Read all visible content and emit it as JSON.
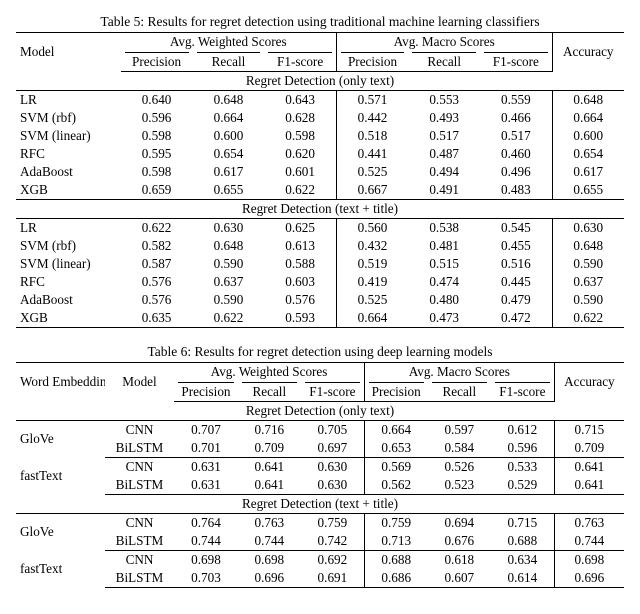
{
  "table5": {
    "caption": "Table 5: Results for regret detection using traditional machine learning classifiers",
    "head": {
      "model": "Model",
      "weighted": "Avg. Weighted Scores",
      "macro": "Avg. Macro Scores",
      "accuracy": "Accuracy",
      "sub": {
        "precision": "Precision",
        "recall": "Recall",
        "f1": "F1-score"
      }
    },
    "sectionA": "Regret Detection (only text)",
    "rowsA": [
      {
        "model": "LR",
        "wP": "0.640",
        "wR": "0.648",
        "wF": "0.643",
        "mP": "0.571",
        "mR": "0.553",
        "mF": "0.559",
        "acc": "0.648",
        "bold": true
      },
      {
        "model": "SVM (rbf)",
        "wP": "0.596",
        "wR": "0.664",
        "wF": "0.628",
        "mP": "0.442",
        "mR": "0.493",
        "mF": "0.466",
        "acc": "0.664"
      },
      {
        "model": "SVM (linear)",
        "wP": "0.598",
        "wR": "0.600",
        "wF": "0.598",
        "mP": "0.518",
        "mR": "0.517",
        "mF": "0.517",
        "acc": "0.600"
      },
      {
        "model": "RFC",
        "wP": "0.595",
        "wR": "0.654",
        "wF": "0.620",
        "mP": "0.441",
        "mR": "0.487",
        "mF": "0.460",
        "acc": "0.654"
      },
      {
        "model": "AdaBoost",
        "wP": "0.598",
        "wR": "0.617",
        "wF": "0.601",
        "mP": "0.525",
        "mR": "0.494",
        "mF": "0.496",
        "acc": "0.617"
      },
      {
        "model": "XGB",
        "wP": "0.659",
        "wR": "0.655",
        "wF": "0.622",
        "mP": "0.667",
        "mR": "0.491",
        "mF": "0.483",
        "acc": "0.655"
      }
    ],
    "sectionB": "Regret Detection (text + title)",
    "rowsB": [
      {
        "model": "LR",
        "wP": "0.622",
        "wR": "0.630",
        "wF": "0.625",
        "mP": "0.560",
        "mR": "0.538",
        "mF": "0.545",
        "acc": "0.630"
      },
      {
        "model": "SVM (rbf)",
        "wP": "0.582",
        "wR": "0.648",
        "wF": "0.613",
        "mP": "0.432",
        "mR": "0.481",
        "mF": "0.455",
        "acc": "0.648"
      },
      {
        "model": "SVM (linear)",
        "wP": "0.587",
        "wR": "0.590",
        "wF": "0.588",
        "mP": "0.519",
        "mR": "0.515",
        "mF": "0.516",
        "acc": "0.590"
      },
      {
        "model": "RFC",
        "wP": "0.576",
        "wR": "0.637",
        "wF": "0.603",
        "mP": "0.419",
        "mR": "0.474",
        "mF": "0.445",
        "acc": "0.637"
      },
      {
        "model": "AdaBoost",
        "wP": "0.576",
        "wR": "0.590",
        "wF": "0.576",
        "mP": "0.525",
        "mR": "0.480",
        "mF": "0.479",
        "acc": "0.590"
      },
      {
        "model": "XGB",
        "wP": "0.635",
        "wR": "0.622",
        "wF": "0.593",
        "mP": "0.664",
        "mR": "0.473",
        "mF": "0.472",
        "acc": "0.622"
      }
    ]
  },
  "table6": {
    "caption": "Table 6: Results for regret detection using deep learning models",
    "head": {
      "embedding": "Word Embedding",
      "model": "Model",
      "weighted": "Avg. Weighted Scores",
      "macro": "Avg. Macro Scores",
      "accuracy": "Accuracy",
      "sub": {
        "precision": "Precision",
        "recall": "Recall",
        "f1": "F1-score"
      }
    },
    "sectionA": "Regret Detection (only text)",
    "groupsA": [
      {
        "emb": "GloVe",
        "rows": [
          {
            "model": "CNN",
            "wP": "0.707",
            "wR": "0.716",
            "wF": "0.705",
            "mP": "0.664",
            "mR": "0.597",
            "mF": "0.612",
            "acc": "0.715"
          },
          {
            "model": "BiLSTM",
            "wP": "0.701",
            "wR": "0.709",
            "wF": "0.697",
            "mP": "0.653",
            "mR": "0.584",
            "mF": "0.596",
            "acc": "0.709"
          }
        ]
      },
      {
        "emb": "fastText",
        "rows": [
          {
            "model": "CNN",
            "wP": "0.631",
            "wR": "0.641",
            "wF": "0.630",
            "mP": "0.569",
            "mR": "0.526",
            "mF": "0.533",
            "acc": "0.641"
          },
          {
            "model": "BiLSTM",
            "wP": "0.631",
            "wR": "0.641",
            "wF": "0.630",
            "mP": "0.562",
            "mR": "0.523",
            "mF": "0.529",
            "acc": "0.641"
          }
        ]
      }
    ],
    "sectionB": "Regret Detection (text + title)",
    "groupsB": [
      {
        "emb": "GloVe",
        "rows": [
          {
            "model": "CNN",
            "wP": "0.764",
            "wR": "0.763",
            "wF": "0.759",
            "mP": "0.759",
            "mR": "0.694",
            "mF": "0.715",
            "acc": "0.763",
            "bold": true
          },
          {
            "model": "BiLSTM",
            "wP": "0.744",
            "wR": "0.744",
            "wF": "0.742",
            "mP": "0.713",
            "mR": "0.676",
            "mF": "0.688",
            "acc": "0.744"
          }
        ]
      },
      {
        "emb": "fastText",
        "rows": [
          {
            "model": "CNN",
            "wP": "0.698",
            "wR": "0.698",
            "wF": "0.692",
            "mP": "0.688",
            "mR": "0.618",
            "mF": "0.634",
            "acc": "0.698"
          },
          {
            "model": "BiLSTM",
            "wP": "0.703",
            "wR": "0.696",
            "wF": "0.691",
            "mP": "0.686",
            "mR": "0.607",
            "mF": "0.614",
            "acc": "0.696"
          }
        ]
      }
    ]
  }
}
